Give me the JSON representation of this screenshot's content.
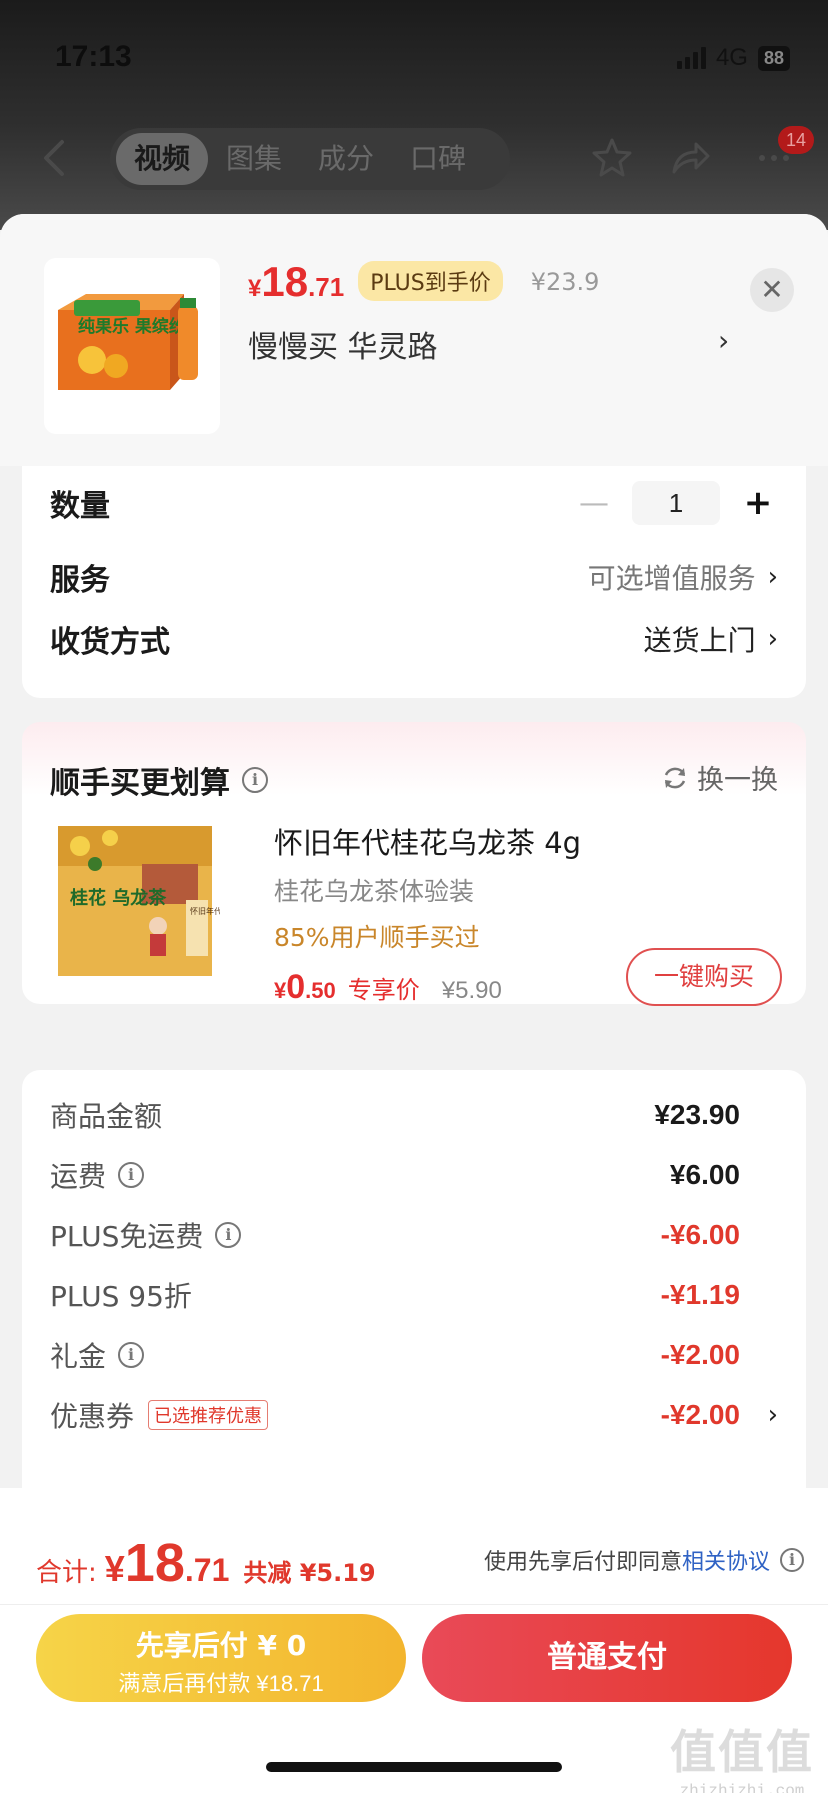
{
  "status_bar": {
    "time": "17:13",
    "network": "4G",
    "battery": "88"
  },
  "nav": {
    "tabs": [
      "视频",
      "图集",
      "成分",
      "口碑"
    ],
    "active_tab": "视频",
    "badge": "14"
  },
  "product": {
    "price_currency": "¥",
    "price_int": "18",
    "price_dec": ".71",
    "plus_tag": "PLUS到手价",
    "original_price": "¥23.9",
    "store": "慢慢买  华灵路",
    "image_label": "纯果乐 果缤纷"
  },
  "options": {
    "quantity_label": "数量",
    "quantity_value": "1",
    "service_label": "服务",
    "service_value": "可选增值服务",
    "delivery_label": "收货方式",
    "delivery_value": "送货上门"
  },
  "addon": {
    "title": "顺手买更划算",
    "swap_label": "换一换",
    "name": "怀旧年代桂花乌龙茶 4g",
    "subtitle": "桂花乌龙茶体验装",
    "bought": "85%用户顺手买过",
    "price_currency": "¥",
    "price_int": "0",
    "price_dec": ".50",
    "exclusive_label": "专享价",
    "old_price": "¥5.90",
    "buy_label": "一键购买",
    "image_text": "桂花 乌龙茶",
    "image_side_text": "怀旧年代"
  },
  "fees": [
    {
      "label": "商品金额",
      "value": "¥23.90",
      "red": false,
      "info": false
    },
    {
      "label": "运费",
      "value": "¥6.00",
      "red": false,
      "info": true
    },
    {
      "label": "PLUS免运费",
      "value": "-¥6.00",
      "red": true,
      "info": true
    },
    {
      "label": "PLUS 95折",
      "value": "-¥1.19",
      "red": true,
      "info": false
    },
    {
      "label": "礼金",
      "value": "-¥2.00",
      "red": true,
      "info": true
    },
    {
      "label": "优惠券",
      "value": "-¥2.00",
      "red": true,
      "info": false,
      "tag": "已选推荐优惠"
    }
  ],
  "total": {
    "label": "合计:",
    "currency": "¥",
    "int": "18",
    "dec": ".71",
    "saved": "共减 ¥5.19"
  },
  "agreement": {
    "text": "使用先享后付即同意",
    "link": "相关协议"
  },
  "buttons": {
    "pay_later_line1": "先享后付 ¥ 0",
    "pay_later_line2": "满意后再付款 ¥18.71",
    "pay_now": "普通支付"
  },
  "watermark": {
    "big": "值值值",
    "small": "zhizhizhi.com"
  },
  "colors": {
    "accent_red": "#e0382c",
    "gold": "#f3b52e",
    "plus_tag_bg": "#fbe7a5"
  }
}
